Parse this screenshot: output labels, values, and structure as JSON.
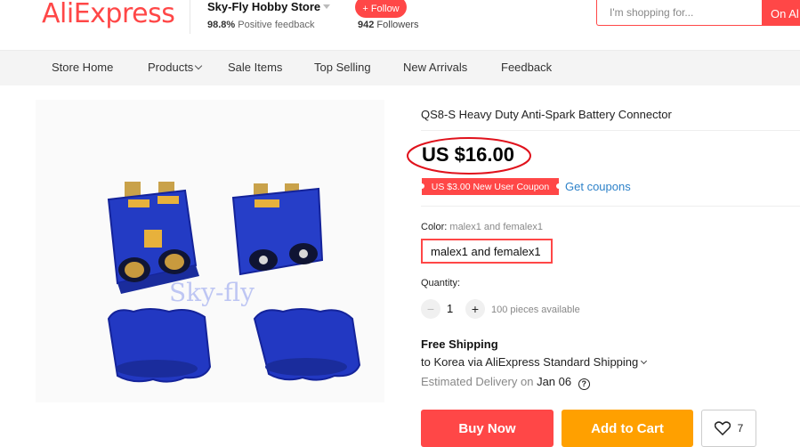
{
  "header": {
    "logo": "AliExpress",
    "store_name": "Sky-Fly Hobby Store",
    "positive_pct": "98.8%",
    "positive_label": "Positive feedback",
    "follow_label": "+ Follow",
    "followers_count": "942",
    "followers_label": "Followers",
    "search_placeholder": "I'm shopping for...",
    "search_button": "On Al"
  },
  "nav": {
    "items": [
      "Store Home",
      "Products",
      "Sale Items",
      "Top Selling",
      "New Arrivals",
      "Feedback"
    ]
  },
  "product": {
    "title": "QS8-S Heavy Duty Anti-Spark Battery Connector",
    "price": "US $16.00",
    "coupon": "US $3.00 New User Coupon",
    "get_coupons": "Get coupons",
    "color_label": "Color:",
    "color_selected": "malex1 and femalex1",
    "color_option": "malex1 and femalex1",
    "quantity_label": "Quantity:",
    "quantity": "1",
    "available": "100 pieces available",
    "shipping_title": "Free Shipping",
    "shipping_route": "to Korea via AliExpress Standard Shipping",
    "delivery_label": "Estimated Delivery on",
    "delivery_date": "Jan 06",
    "buy_now": "Buy Now",
    "add_to_cart": "Add to Cart",
    "wishlist_count": "7",
    "watermark": "Sky-fly"
  },
  "colors": {
    "accent": "#ff4747",
    "cart": "#ffa000",
    "link": "#2e82c9",
    "connector_blue": "#1f34b8"
  },
  "icons": {
    "store_dropdown": "chevron-down-icon",
    "products_dropdown": "chevron-down-icon",
    "shipping_dropdown": "chevron-down-icon",
    "help": "question-circle-icon",
    "wishlist": "heart-icon"
  }
}
